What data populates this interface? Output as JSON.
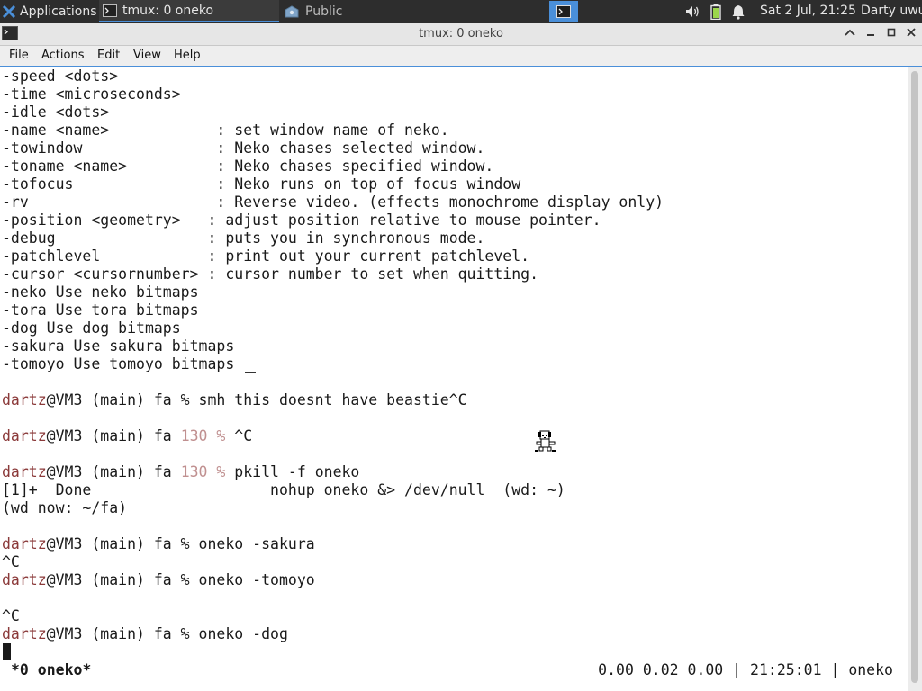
{
  "panel": {
    "applications_label": "Applications",
    "task_active_label": "tmux: 0 oneko",
    "task_other_label": "Public",
    "clock": "Sat  2 Jul, 21:25",
    "user": "Darty uwu",
    "icons": [
      "xfce-icon",
      "terminal-icon",
      "folder-icon",
      "terminal-icon",
      "volume-icon",
      "battery-icon",
      "notification-bell-icon"
    ]
  },
  "window": {
    "title": "tmux: 0 oneko",
    "buttons": [
      "minimize-up",
      "minimize",
      "maximize",
      "close"
    ]
  },
  "menubar": {
    "items": [
      "File",
      "Actions",
      "Edit",
      "View",
      "Help"
    ]
  },
  "terminal": {
    "lines": [
      {
        "t": "-speed <dots>"
      },
      {
        "t": "-time <microseconds>"
      },
      {
        "t": "-idle <dots>"
      },
      {
        "t": "-name <name>            : set window name of neko."
      },
      {
        "t": "-towindow               : Neko chases selected window."
      },
      {
        "t": "-toname <name>          : Neko chases specified window."
      },
      {
        "t": "-tofocus                : Neko runs on top of focus window"
      },
      {
        "t": "-rv                     : Reverse video. (effects monochrome display only)"
      },
      {
        "t": "-position <geometry>   : adjust position relative to mouse pointer."
      },
      {
        "t": "-debug                 : puts you in synchronous mode."
      },
      {
        "t": "-patchlevel            : print out your current patchlevel."
      },
      {
        "t": "-cursor <cursornumber> : cursor number to set when quitting."
      },
      {
        "t": "-neko Use neko bitmaps"
      },
      {
        "t": "-tora Use tora bitmaps"
      },
      {
        "t": "-dog Use dog bitmaps"
      },
      {
        "t": "-sakura Use sakura bitmaps"
      },
      {
        "t": "-tomoyo Use tomoyo bitmaps"
      },
      {
        "t": ""
      },
      {
        "u": "dartz",
        "t": "@VM3 (main) fa % smh this doesnt have beastie^C"
      },
      {
        "t": ""
      },
      {
        "u": "dartz",
        "pre": "@VM3 (main) fa ",
        "ret": "130 %",
        "t": " ^C"
      },
      {
        "t": ""
      },
      {
        "u": "dartz",
        "pre": "@VM3 (main) fa ",
        "ret": "130 %",
        "t": " pkill -f oneko"
      },
      {
        "t": "[1]+  Done                    nohup oneko &> /dev/null  (wd: ~)"
      },
      {
        "t": "(wd now: ~/fa)"
      },
      {
        "t": ""
      },
      {
        "u": "dartz",
        "t": "@VM3 (main) fa % oneko -sakura"
      },
      {
        "t": "^C"
      },
      {
        "u": "dartz",
        "t": "@VM3 (main) fa % oneko -tomoyo"
      },
      {
        "t": ""
      },
      {
        "t": "^C"
      },
      {
        "u": "dartz",
        "t": "@VM3 (main) fa % oneko -dog"
      }
    ]
  },
  "tmux_status": {
    "window": "*0 oneko*",
    "right": "0.00 0.02 0.00 | 21:25:01 | oneko"
  },
  "colors": {
    "accent": "#4a8fd9",
    "username": "#8b3a3a",
    "return_code": "#c09090"
  }
}
